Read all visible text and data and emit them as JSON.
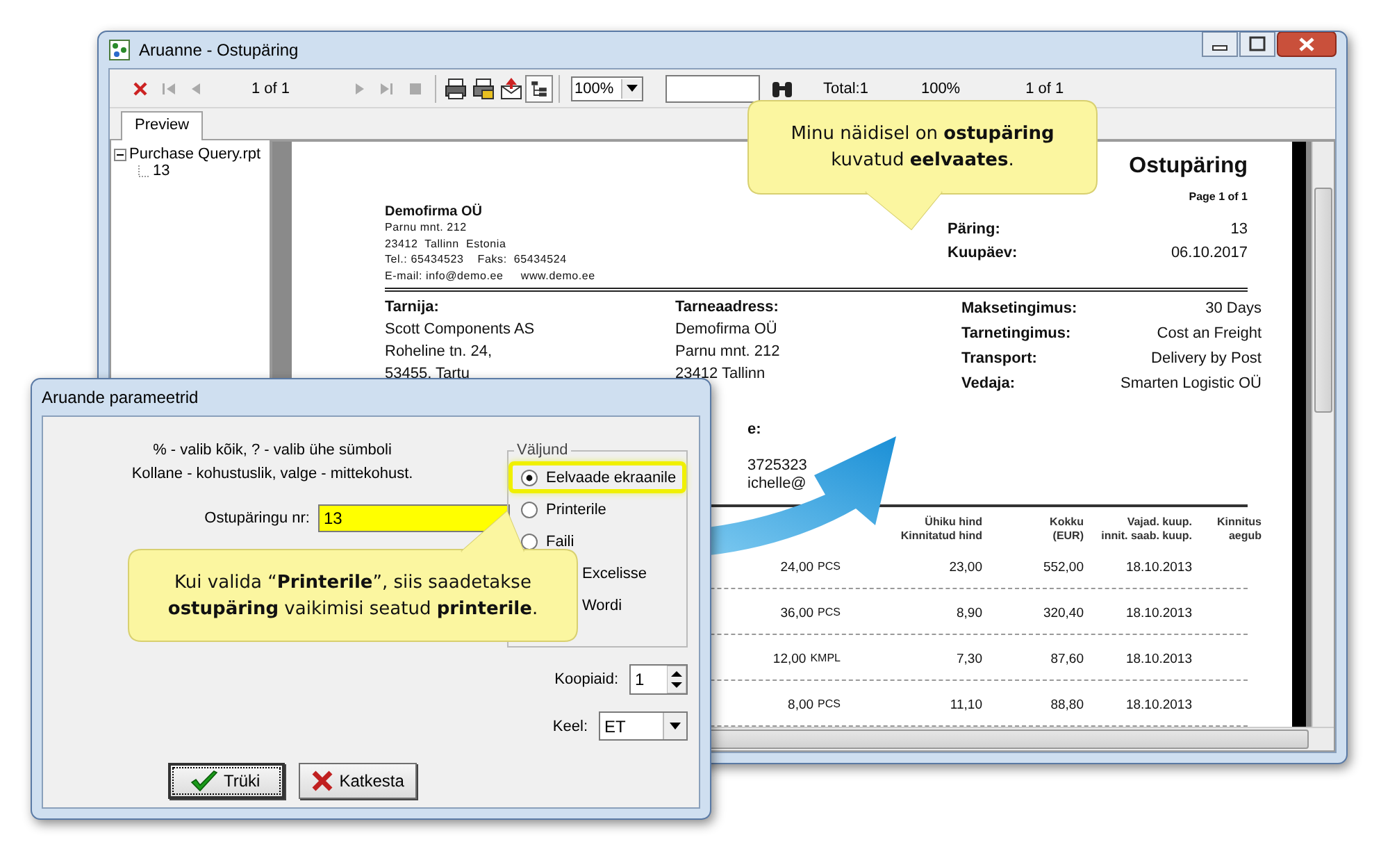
{
  "main_window": {
    "title": "Aruanne - Ostupäring",
    "toolbar": {
      "page_indicator": "1 of 1",
      "zoom": "100%",
      "group_tree_toggled": true,
      "total": "Total:1",
      "zoom_status": "100%",
      "page_status": "1 of 1"
    },
    "tabs": [
      {
        "label": "Preview",
        "selected": true
      }
    ],
    "tree": [
      {
        "label": "Purchase Query.rpt",
        "expanded": true,
        "children": [
          {
            "label": "13"
          }
        ]
      }
    ],
    "report": {
      "title": "Ostupäring",
      "page": "Page 1 of 1",
      "company": {
        "name": "Demofirma OÜ",
        "lines": [
          "Parnu mnt. 212",
          "23412  Tallinn  Estonia",
          "Tel.: 65434523    Faks:  65434524",
          "E-mail: info@demo.ee     www.demo.ee"
        ]
      },
      "meta": [
        {
          "label": "Päring:",
          "value": "13"
        },
        {
          "label": "Kuupäev:",
          "value": "06.10.2017"
        }
      ],
      "supplier": {
        "heading": "Tarnija:",
        "lines": [
          "Scott Components AS",
          "Roheline tn. 24,",
          "53455, Tartu"
        ]
      },
      "delivery": {
        "heading": "Tarneaadress:",
        "lines": [
          "Demofirma OÜ",
          "Parnu mnt. 212",
          "23412 Tallinn"
        ]
      },
      "terms": [
        {
          "label": "Maksetingimus:",
          "value": "30 Days"
        },
        {
          "label": "Tarnetingimus:",
          "value": "Cost an Freight"
        },
        {
          "label": "Transport:",
          "value": "Delivery by Post"
        },
        {
          "label": "Vedaja:",
          "value": "Smarten Logistic OÜ"
        }
      ],
      "contact": {
        "heading": "e:",
        "lines": [
          "3725323",
          "ichelle@"
        ]
      },
      "columns": [
        {
          "lines": [
            "Ühiku hind",
            "Kinnitatud hind"
          ]
        },
        {
          "lines": [
            "Kokku",
            "(EUR)"
          ]
        },
        {
          "lines": [
            "Vajad. kuup.",
            "innit. saab. kuup."
          ]
        },
        {
          "lines": [
            "Kinnitus",
            "aegub"
          ]
        }
      ],
      "rows": [
        {
          "quantity": "24,00",
          "unit": "PCS",
          "price": "23,00",
          "total": "552,00",
          "date": "18.10.2013"
        },
        {
          "quantity": "36,00",
          "unit": "PCS",
          "price": "8,90",
          "total": "320,40",
          "date": "18.10.2013"
        },
        {
          "quantity": "12,00",
          "unit": "KMPL",
          "price": "7,30",
          "total": "87,60",
          "date": "18.10.2013"
        },
        {
          "quantity": "8,00",
          "unit": "PCS",
          "price": "11,10",
          "total": "88,80",
          "date": "18.10.2013"
        }
      ]
    }
  },
  "dialog": {
    "title": "Aruande parameetrid",
    "hints": [
      "% - valib kõik, ? - valib ühe sümboli",
      "Kollane - kohustuslik, valge - mittekohust."
    ],
    "field": {
      "label": "Ostupäringu nr:",
      "value": "13",
      "required": true
    },
    "output": {
      "legend": "Väljund",
      "options": [
        {
          "label": "Eelvaade ekraanile",
          "selected": true,
          "highlighted": true
        },
        {
          "label": "Printerile",
          "selected": false,
          "highlighted": false
        },
        {
          "label": "Faili",
          "selected": false,
          "highlighted": false
        },
        {
          "label": "Excelisse"
        },
        {
          "label": "Wordi"
        }
      ]
    },
    "copies": {
      "label": "Koopiaid:",
      "value": "1"
    },
    "language": {
      "label": "Keel:",
      "value": "ET"
    },
    "buttons": [
      {
        "label": "Trüki",
        "kind": "ok",
        "default": true
      },
      {
        "label": "Katkesta",
        "kind": "cancel",
        "default": false
      }
    ]
  },
  "callouts": [
    {
      "text": "Minu näidisel on **ostupäring** kuvatud **eelvaates**.",
      "kind": "down"
    },
    {
      "text": "Kui valida “**Printerile**”, siis saadetakse **ostupäring** vaikimisi seatud **printerile**.",
      "kind": "up"
    }
  ]
}
